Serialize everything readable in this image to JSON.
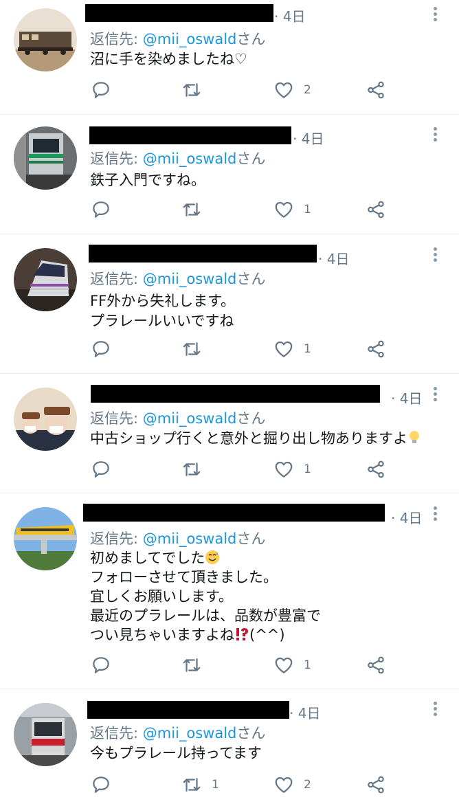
{
  "tweets": [
    {
      "time": "· 4日",
      "reply_prefix": "返信先: ",
      "reply_handle": "@mii_oswald",
      "reply_suffix": "さん",
      "lines": [
        "沼に手を染めましたね♡"
      ],
      "likes": "2",
      "retweets": ""
    },
    {
      "time": "· 4日",
      "reply_prefix": "返信先: ",
      "reply_handle": "@mii_oswald",
      "reply_suffix": "さん",
      "lines": [
        "鉄子入門ですね。"
      ],
      "likes": "1",
      "retweets": ""
    },
    {
      "time": "· 4日",
      "reply_prefix": "返信先: ",
      "reply_handle": "@mii_oswald",
      "reply_suffix": "さん",
      "lines": [
        "FF外から失礼します。",
        "プラレールいいですね"
      ],
      "likes": "1",
      "retweets": ""
    },
    {
      "time": "· 4日",
      "reply_prefix": "返信先: ",
      "reply_handle": "@mii_oswald",
      "reply_suffix": "さん",
      "lines": [
        "中古ショップ行くと意外と掘り出し物ありますよ"
      ],
      "likes": "1",
      "retweets": ""
    },
    {
      "time": "· 4日",
      "reply_prefix": "返信先: ",
      "reply_handle": "@mii_oswald",
      "reply_suffix": "さん",
      "lines": [
        "初めましてでした",
        "フォローさせて頂きました。",
        "宜しくお願いします。",
        "最近のプラレールは、品数が豊富で",
        "つい見ちゃいますよね",
        "(^^)"
      ],
      "likes": "1",
      "retweets": ""
    },
    {
      "time": "· 4日",
      "reply_prefix": "返信先: ",
      "reply_handle": "@mii_oswald",
      "reply_suffix": "さん",
      "lines": [
        "今もプラレール持ってます"
      ],
      "likes": "2",
      "retweets": "1"
    }
  ],
  "icons": {
    "reply": "reply-icon",
    "retweet": "retweet-icon",
    "like": "heart-icon",
    "share": "share-icon",
    "more": "more-icon",
    "emoji_bulb": "lightbulb-emoji",
    "emoji_sweat": "sweat-smile-emoji",
    "emoji_interrobang": "interrobang-emoji"
  },
  "colors": {
    "handle": "#1b95e0",
    "meta": "#657786",
    "icon": "#657786",
    "divider": "#e6ecf0",
    "redaction": "#000000"
  }
}
